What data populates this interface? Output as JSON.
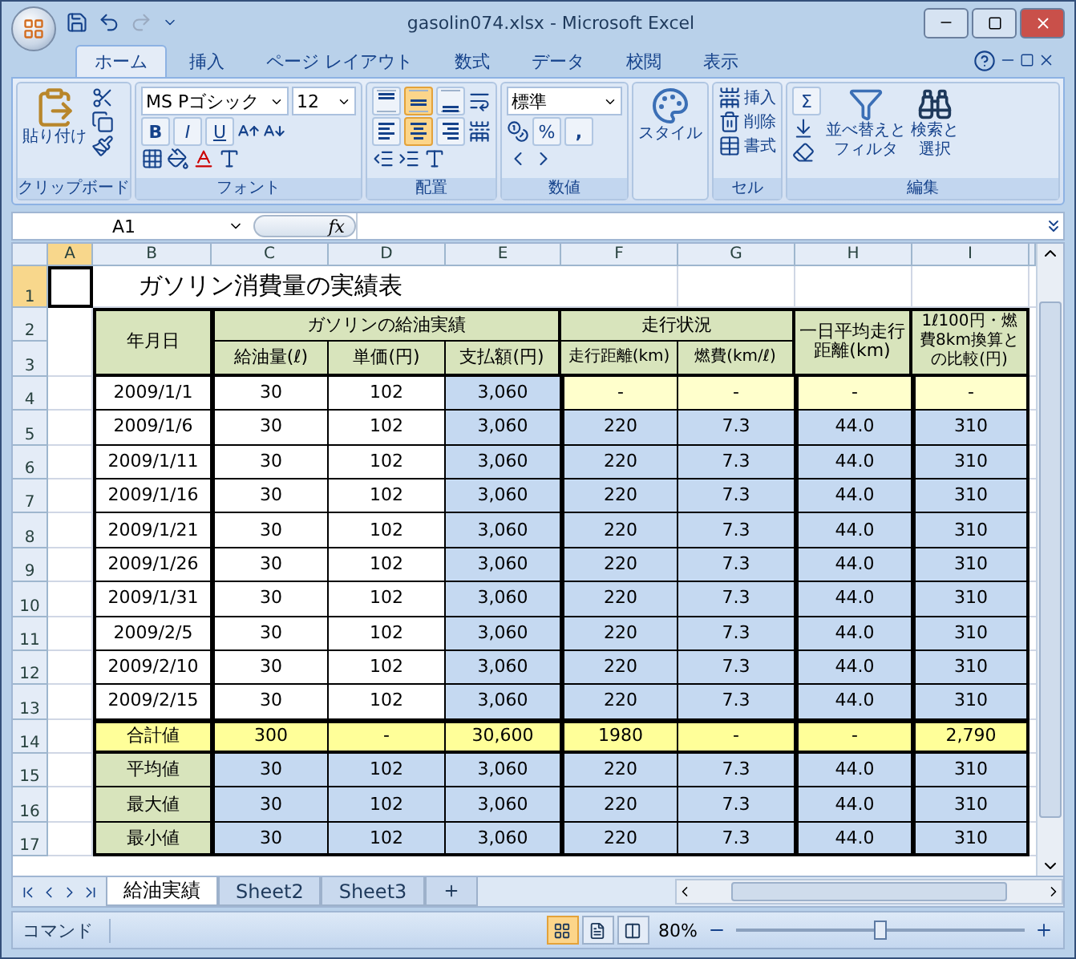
{
  "window": {
    "title": "gasolin074.xlsx - Microsoft Excel"
  },
  "ribbon_tabs": [
    {
      "label": "ホーム",
      "selected": true
    },
    {
      "label": "挿入",
      "selected": false
    },
    {
      "label": "ページ レイアウト",
      "selected": false
    },
    {
      "label": "数式",
      "selected": false
    },
    {
      "label": "データ",
      "selected": false
    },
    {
      "label": "校閲",
      "selected": false
    },
    {
      "label": "表示",
      "selected": false
    }
  ],
  "ribbon": {
    "clipboard": {
      "label": "クリップボード",
      "paste": "貼り付け"
    },
    "font": {
      "label": "フォント",
      "font_name": "MS Pゴシック",
      "font_size": "12",
      "bold": "B",
      "italic": "I",
      "underline": "U"
    },
    "alignment": {
      "label": "配置",
      "vertical": [
        {
          "kind": "top",
          "selected": false
        },
        {
          "kind": "middle",
          "selected": true
        },
        {
          "kind": "bottom",
          "selected": false
        }
      ],
      "horizontal": [
        {
          "kind": "left",
          "selected": false
        },
        {
          "kind": "center",
          "selected": true
        },
        {
          "kind": "right",
          "selected": false
        }
      ]
    },
    "number": {
      "label": "数値",
      "format": "標準",
      "percent": "%",
      "comma": ","
    },
    "styles": {
      "label": "スタイル"
    },
    "cells": {
      "label": "セル",
      "insert": "挿入",
      "delete": "削除",
      "format": "書式"
    },
    "editing": {
      "label": "編集",
      "sum": "Σ",
      "sort": [
        "並べ替えと",
        "フィルタ"
      ],
      "find": [
        "検索と",
        "選択"
      ]
    }
  },
  "formula_bar": {
    "name_box": "A1",
    "fx": "fx"
  },
  "columns": [
    {
      "label": "A",
      "selected": true
    },
    {
      "label": "B",
      "selected": false
    },
    {
      "label": "C",
      "selected": false
    },
    {
      "label": "D",
      "selected": false
    },
    {
      "label": "E",
      "selected": false
    },
    {
      "label": "F",
      "selected": false
    },
    {
      "label": "G",
      "selected": false
    },
    {
      "label": "H",
      "selected": false
    },
    {
      "label": "I",
      "selected": false
    }
  ],
  "row_numbers": [
    {
      "label": "1",
      "selected": true
    },
    {
      "label": "2",
      "selected": false
    },
    {
      "label": "3",
      "selected": false
    },
    {
      "label": "4",
      "selected": false
    },
    {
      "label": "5",
      "selected": false
    },
    {
      "label": "6",
      "selected": false
    },
    {
      "label": "7",
      "selected": false
    },
    {
      "label": "8",
      "selected": false
    },
    {
      "label": "9",
      "selected": false
    },
    {
      "label": "10",
      "selected": false
    },
    {
      "label": "11",
      "selected": false
    },
    {
      "label": "12",
      "selected": false
    },
    {
      "label": "13",
      "selected": false
    },
    {
      "label": "14",
      "selected": false
    },
    {
      "label": "15",
      "selected": false
    },
    {
      "label": "16",
      "selected": false
    },
    {
      "label": "17",
      "selected": false
    }
  ],
  "sheet": {
    "title": "ガソリン消費量の実績表",
    "header": {
      "date": "年月日",
      "group_fuel": "ガソリンの給油実績",
      "group_drive": "走行状況",
      "daily": "一日平均走行距離(km)",
      "compare": "1ℓ100円・燃費8km換算との比較(円)",
      "columns": [
        "給油量(ℓ)",
        "単価(円)",
        "支払額(円)",
        "走行距離(km)",
        "燃費(km/ℓ)"
      ]
    },
    "rows": [
      {
        "kind": "first",
        "cells": [
          "2009/1/1",
          "30",
          "102",
          "3,060",
          "-",
          "-",
          "-",
          "-"
        ]
      },
      {
        "kind": "data",
        "cells": [
          "2009/1/6",
          "30",
          "102",
          "3,060",
          "220",
          "7.3",
          "44.0",
          "310"
        ]
      },
      {
        "kind": "data",
        "cells": [
          "2009/1/11",
          "30",
          "102",
          "3,060",
          "220",
          "7.3",
          "44.0",
          "310"
        ]
      },
      {
        "kind": "data",
        "cells": [
          "2009/1/16",
          "30",
          "102",
          "3,060",
          "220",
          "7.3",
          "44.0",
          "310"
        ]
      },
      {
        "kind": "data",
        "cells": [
          "2009/1/21",
          "30",
          "102",
          "3,060",
          "220",
          "7.3",
          "44.0",
          "310"
        ]
      },
      {
        "kind": "data",
        "cells": [
          "2009/1/26",
          "30",
          "102",
          "3,060",
          "220",
          "7.3",
          "44.0",
          "310"
        ]
      },
      {
        "kind": "data",
        "cells": [
          "2009/1/31",
          "30",
          "102",
          "3,060",
          "220",
          "7.3",
          "44.0",
          "310"
        ]
      },
      {
        "kind": "data",
        "cells": [
          "2009/2/5",
          "30",
          "102",
          "3,060",
          "220",
          "7.3",
          "44.0",
          "310"
        ]
      },
      {
        "kind": "data",
        "cells": [
          "2009/2/10",
          "30",
          "102",
          "3,060",
          "220",
          "7.3",
          "44.0",
          "310"
        ]
      },
      {
        "kind": "data",
        "cells": [
          "2009/2/15",
          "30",
          "102",
          "3,060",
          "220",
          "7.3",
          "44.0",
          "310"
        ]
      },
      {
        "kind": "total",
        "cells": [
          "合計値",
          "300",
          "-",
          "30,600",
          "1980",
          "-",
          "-",
          "2,790"
        ]
      },
      {
        "kind": "stat",
        "cells": [
          "平均値",
          "30",
          "102",
          "3,060",
          "220",
          "7.3",
          "44.0",
          "310"
        ]
      },
      {
        "kind": "stat",
        "cells": [
          "最大値",
          "30",
          "102",
          "3,060",
          "220",
          "7.3",
          "44.0",
          "310"
        ]
      },
      {
        "kind": "stat",
        "cells": [
          "最小値",
          "30",
          "102",
          "3,060",
          "220",
          "7.3",
          "44.0",
          "310"
        ]
      }
    ]
  },
  "sheet_tabs": [
    {
      "label": "給油実績",
      "selected": true
    },
    {
      "label": "Sheet2",
      "selected": false
    },
    {
      "label": "Sheet3",
      "selected": false
    }
  ],
  "status_bar": {
    "mode": "コマンド",
    "zoom": "80%",
    "views": [
      {
        "kind": "normal",
        "selected": true
      },
      {
        "kind": "layout",
        "selected": false
      },
      {
        "kind": "pagebreak",
        "selected": false
      }
    ],
    "zoom_slider": {
      "level": 0.5
    }
  }
}
